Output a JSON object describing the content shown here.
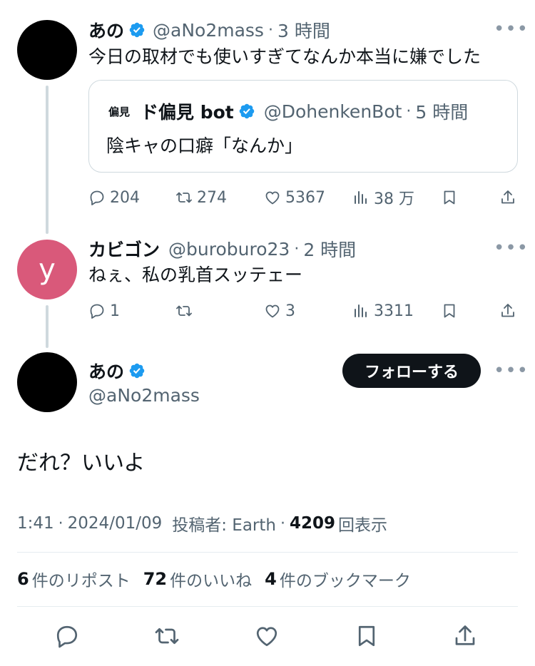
{
  "tweet1": {
    "name": "あの",
    "handle": "@aNo2mass",
    "time": "3 時間",
    "text": "今日の取材でも使いすぎてなんか本当に嫌でした",
    "quote": {
      "avatar_text": "偏見",
      "name": "ド偏見 bot",
      "handle": "@DohenkenBot",
      "time": "5 時間",
      "text": "陰キャの口癖「なんか」"
    },
    "replies": "204",
    "reposts": "274",
    "likes": "5367",
    "views": "38 万"
  },
  "tweet2": {
    "avatar_letter": "y",
    "name": "カビゴン",
    "handle": "@buroburo23",
    "time": "2 時間",
    "text": "ねぇ、私の乳首スッテェー",
    "replies": "1",
    "reposts": "",
    "likes": "3",
    "views": "3311"
  },
  "main": {
    "name": "あの",
    "handle": "@aNo2mass",
    "follow_label": "フォローする",
    "text": "だれ？いいよ",
    "time": "1:41",
    "date": "2024/01/09",
    "source_prefix": "投稿者: Earth",
    "views_count": "4209",
    "views_label": "回表示",
    "reposts_count": "6",
    "reposts_label": "件のリポスト",
    "likes_count": "72",
    "likes_label": "件のいいね",
    "bookmarks_count": "4",
    "bookmarks_label": "件のブックマーク"
  },
  "icons": {
    "more": "more-icon",
    "verified": "verified-badge-icon",
    "reply": "reply-icon",
    "repost": "repost-icon",
    "like": "heart-icon",
    "views": "views-icon",
    "bookmark": "bookmark-icon",
    "share": "share-icon"
  },
  "colors": {
    "verified": "#1d9bf0",
    "follow_button": "#0f1419",
    "muted": "#536471",
    "avatar_y": "#d9597a"
  }
}
